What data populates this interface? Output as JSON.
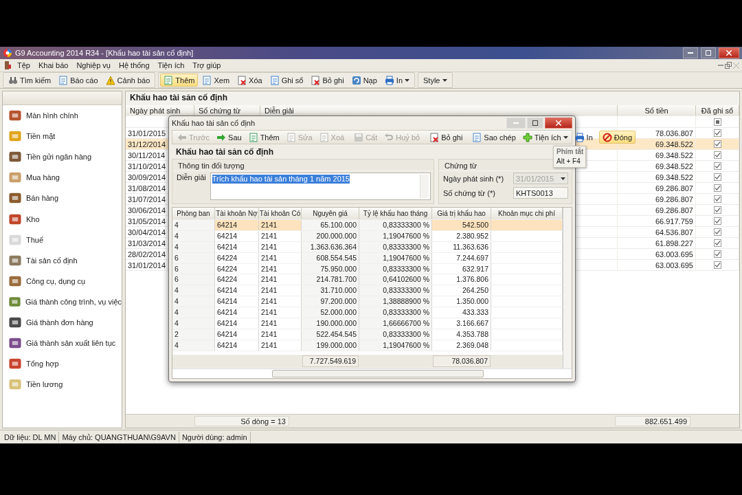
{
  "window": {
    "title": "G9 Accounting 2014 R34 - [Khấu hao tài sản cố định]"
  },
  "menu": [
    {
      "label": "Tệp"
    },
    {
      "label": "Khai báo"
    },
    {
      "label": "Nghiệp vụ"
    },
    {
      "label": "Hệ thống"
    },
    {
      "label": "Tiện ích"
    },
    {
      "label": "Trợ giúp"
    }
  ],
  "toolbar": [
    [
      {
        "label": "Tìm kiếm",
        "active": false,
        "dropdown": false
      },
      {
        "label": "Báo cáo",
        "active": false,
        "dropdown": false
      },
      {
        "label": "Cảnh báo",
        "active": false,
        "dropdown": false
      }
    ],
    [
      {
        "label": "Thêm",
        "active": true,
        "dropdown": false
      },
      {
        "label": "Xem",
        "active": false,
        "dropdown": false
      },
      {
        "label": "Xóa",
        "active": false,
        "dropdown": false
      },
      {
        "label": "Ghi sổ",
        "active": false,
        "dropdown": false
      },
      {
        "label": "Bỏ ghi",
        "active": false,
        "dropdown": false
      },
      {
        "label": "Nạp",
        "active": false,
        "dropdown": false
      },
      {
        "label": "In",
        "active": false,
        "dropdown": true
      }
    ],
    [
      {
        "label": "Style",
        "active": false,
        "dropdown": true
      }
    ]
  ],
  "sidebar": {
    "items": [
      {
        "label": "Màn hình chính"
      },
      {
        "label": "Tiền mặt"
      },
      {
        "label": "Tiền gửi ngân hàng"
      },
      {
        "label": "Mua hàng"
      },
      {
        "label": "Bán hàng"
      },
      {
        "label": "Kho"
      },
      {
        "label": "Thuế"
      },
      {
        "label": "Tài sản cố định"
      },
      {
        "label": "Công cụ, dụng cụ"
      },
      {
        "label": "Giá thành công trình, vụ việc"
      },
      {
        "label": "Giá thành đơn hàng"
      },
      {
        "label": "Giá thành sản xuất liên tục"
      },
      {
        "label": "Tổng hợp"
      },
      {
        "label": "Tiền lương"
      }
    ]
  },
  "list": {
    "title": "Khấu hao tài sản cố định",
    "columns": [
      "Ngày phát sinh",
      "Số chứng từ",
      "Diễn giải",
      "Số tiền",
      "Đã ghi sổ"
    ],
    "filter": {
      "posted_partial": true
    },
    "rows": [
      {
        "date": "31/01/2015",
        "amount": "78.036.807",
        "posted": true,
        "selected": false
      },
      {
        "date": "31/12/2014",
        "amount": "69.348.522",
        "posted": true,
        "selected": true
      },
      {
        "date": "30/11/2014",
        "amount": "69.348.522",
        "posted": true,
        "selected": false
      },
      {
        "date": "31/10/2014",
        "amount": "69.348.522",
        "posted": true,
        "selected": false
      },
      {
        "date": "30/09/2014",
        "amount": "69.348.522",
        "posted": true,
        "selected": false
      },
      {
        "date": "31/08/2014",
        "amount": "69.286.807",
        "posted": true,
        "selected": false
      },
      {
        "date": "31/07/2014",
        "amount": "69.286.807",
        "posted": true,
        "selected": false
      },
      {
        "date": "30/06/2014",
        "amount": "69.286.807",
        "posted": true,
        "selected": false
      },
      {
        "date": "31/05/2014",
        "amount": "66.917.759",
        "posted": true,
        "selected": false
      },
      {
        "date": "30/04/2014",
        "amount": "64.536.807",
        "posted": true,
        "selected": false
      },
      {
        "date": "31/03/2014",
        "amount": "61.898.227",
        "posted": true,
        "selected": false
      },
      {
        "date": "28/02/2014",
        "amount": "63.003.695",
        "posted": true,
        "selected": false
      },
      {
        "date": "31/01/2014",
        "amount": "63.003.695",
        "posted": true,
        "selected": false
      }
    ],
    "footer": {
      "row_count": "Số dòng = 13",
      "total": "882.651.499"
    }
  },
  "dialog": {
    "title": "Khấu hao tài sản cố định",
    "toolbar": [
      {
        "label": "Trước",
        "disabled": true,
        "dropdown": false,
        "hovered": false
      },
      {
        "label": "Sau",
        "disabled": false,
        "dropdown": false,
        "hovered": false
      },
      {
        "label": "Thêm",
        "disabled": false,
        "dropdown": false,
        "hovered": false
      },
      {
        "label": "Sửa",
        "disabled": true,
        "dropdown": false,
        "hovered": false
      },
      {
        "label": "Xoá",
        "disabled": true,
        "dropdown": false,
        "hovered": false
      },
      {
        "label": "Cất",
        "disabled": true,
        "dropdown": false,
        "hovered": false
      },
      {
        "label": "Huỷ bỏ",
        "disabled": true,
        "dropdown": false,
        "hovered": false
      },
      {
        "label": "Bỏ ghi",
        "disabled": false,
        "dropdown": false,
        "hovered": false
      },
      {
        "label": "Sao chép",
        "disabled": false,
        "dropdown": false,
        "hovered": false
      },
      {
        "label": "Tiện ích",
        "disabled": false,
        "dropdown": true,
        "hovered": false
      },
      {
        "label": "In",
        "disabled": false,
        "dropdown": false,
        "hovered": false
      },
      {
        "label": "Đóng",
        "disabled": false,
        "dropdown": false,
        "hovered": true
      }
    ],
    "heading": "Khấu hao tài sản cố định",
    "object_group": {
      "title": "Thông tin đối tượng",
      "label": "Diễn giải",
      "value": "Trích khấu hao tài sản tháng 1 năm 2015",
      "text_selected": true
    },
    "voucher_group": {
      "title": "Chứng từ",
      "fields": [
        {
          "label": "Ngày phát sinh (*)",
          "value": "31/01/2015",
          "disabled": true,
          "dropdown": true
        },
        {
          "label": "Số chứng từ (*)",
          "value": "KHTS0013",
          "disabled": false,
          "dropdown": false
        }
      ]
    },
    "grid": {
      "columns": [
        "Phòng ban",
        "Tài khoản Nợ",
        "Tài khoản Có",
        "Nguyên giá",
        "Tỷ lệ khấu hao tháng",
        "Giá trị khấu hao",
        "Khoản mục chi phí"
      ],
      "rows": [
        {
          "cells": [
            "4",
            "64214",
            "2141",
            "65.100.000",
            "0,83333300 %",
            "542.500"
          ],
          "selected": true
        },
        {
          "cells": [
            "4",
            "64214",
            "2141",
            "200.000.000",
            "1,19047600 %",
            "2.380.952"
          ],
          "selected": false
        },
        {
          "cells": [
            "4",
            "64214",
            "2141",
            "1.363.636.364",
            "0,83333300 %",
            "11.363.636"
          ],
          "selected": false
        },
        {
          "cells": [
            "6",
            "64224",
            "2141",
            "608.554.545",
            "1,19047600 %",
            "7.244.697"
          ],
          "selected": false
        },
        {
          "cells": [
            "6",
            "64224",
            "2141",
            "75.950.000",
            "0,83333300 %",
            "632.917"
          ],
          "selected": false
        },
        {
          "cells": [
            "6",
            "64224",
            "2141",
            "214.781.700",
            "0,64102600 %",
            "1.376.806"
          ],
          "selected": false
        },
        {
          "cells": [
            "4",
            "64214",
            "2141",
            "31.710.000",
            "0,83333300 %",
            "264.250"
          ],
          "selected": false
        },
        {
          "cells": [
            "4",
            "64214",
            "2141",
            "97.200.000",
            "1,38888900 %",
            "1.350.000"
          ],
          "selected": false
        },
        {
          "cells": [
            "4",
            "64214",
            "2141",
            "52.000.000",
            "0,83333300 %",
            "433.333"
          ],
          "selected": false
        },
        {
          "cells": [
            "4",
            "64214",
            "2141",
            "190.000.000",
            "1,66666700 %",
            "3.166.667"
          ],
          "selected": false
        },
        {
          "cells": [
            "2",
            "64214",
            "2141",
            "522.454.545",
            "0,83333300 %",
            "4.353.788"
          ],
          "selected": false
        },
        {
          "cells": [
            "4",
            "64214",
            "2141",
            "199.000.000",
            "1,19047600 %",
            "2.369.048"
          ],
          "selected": false
        }
      ],
      "totals": {
        "original_cost": "7.727.549.619",
        "depreciation": "78.036.807"
      }
    },
    "tooltip": {
      "title": "Phím tắt",
      "text": "Alt + F4"
    }
  },
  "status_bar": [
    {
      "text": "Dữ liệu: DL MN"
    },
    {
      "text": "Máy chủ: QUANGTHUAN\\G9AVN"
    },
    {
      "text": "Người dùng: admin"
    }
  ]
}
